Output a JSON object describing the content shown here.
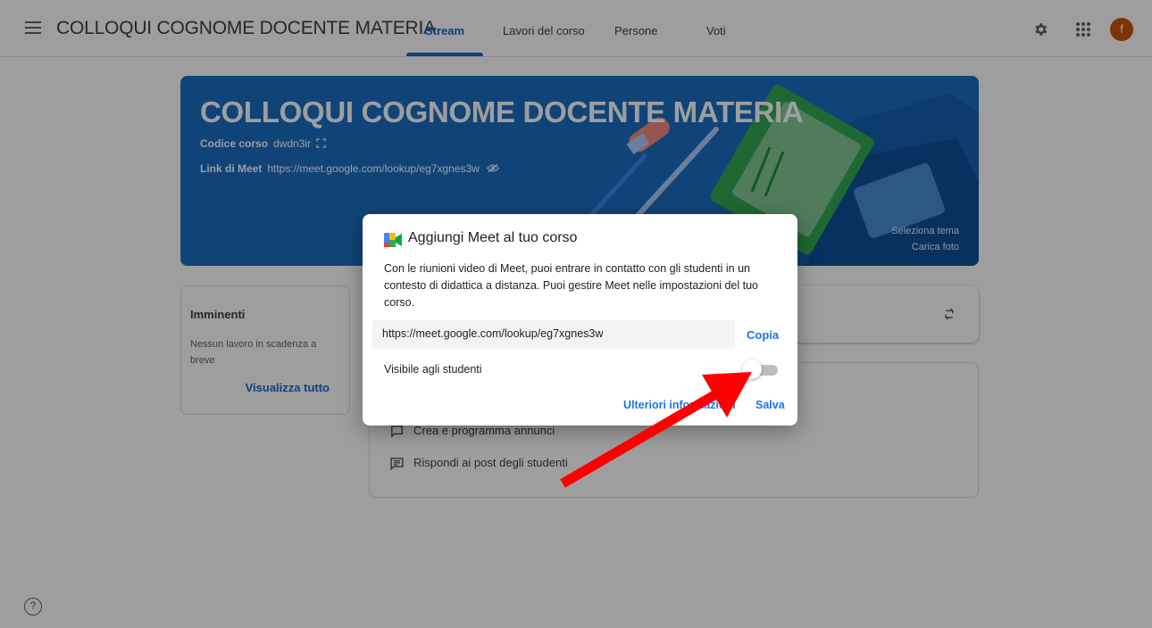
{
  "header": {
    "course_name": "COLLOQUI COGNOME DOCENTE MATERIA",
    "tabs": [
      {
        "label": "Stream"
      },
      {
        "label": "Lavori del corso"
      },
      {
        "label": "Persone"
      },
      {
        "label": "Voti"
      }
    ],
    "avatar_letter": "f"
  },
  "banner": {
    "title": "COLLOQUI COGNOME DOCENTE MATERIA",
    "code_label": "Codice corso",
    "code_value": "dwdn3ir",
    "meet_label": "Link di Meet",
    "meet_value": "https://meet.google.com/lookup/eg7xgnes3w",
    "select_theme": "Seleziona tema",
    "upload_photo": "Carica foto"
  },
  "upcoming": {
    "title": "Imminenti",
    "text": "Nessun lavoro in scadenza a breve",
    "view_all": "Visualizza tutto"
  },
  "stream": {
    "items": [
      {
        "label": "Crea e programma annunci"
      },
      {
        "label": "Rispondi ai post degli studenti"
      }
    ]
  },
  "dialog": {
    "title": "Aggiungi Meet al tuo corso",
    "body": "Con le riunioni video di Meet, puoi entrare in contatto con gli studenti in un contesto di didattica a distanza. Puoi gestire Meet nelle impostazioni del tuo corso.",
    "url": "https://meet.google.com/lookup/eg7xgnes3w",
    "copy_label": "Copia",
    "visible_label": "Visibile agli studenti",
    "visible_to_students": false,
    "more_info": "Ulteriori informazioni",
    "save_label": "Salva"
  },
  "colors": {
    "accent": "#1967d2",
    "banner": "#1a6fc4",
    "annotation_arrow": "#ff0000",
    "avatar": "#c5540b"
  },
  "help_icon": "?"
}
